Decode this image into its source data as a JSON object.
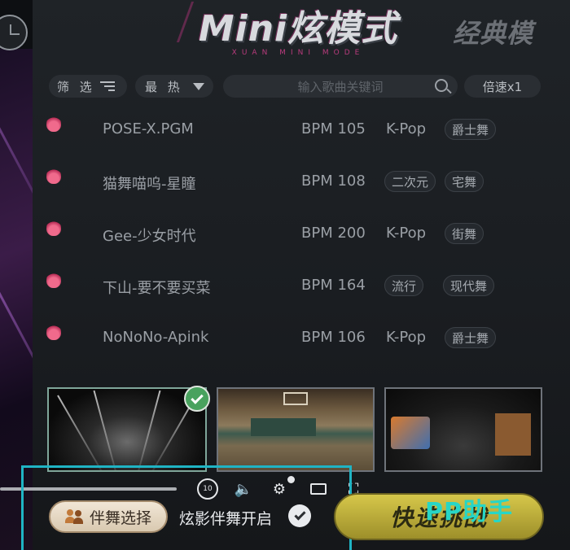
{
  "header": {
    "title": "Mini炫模式",
    "subtitle": "XUAN MINI MODE",
    "classic_tab": "经典模"
  },
  "toolbar": {
    "filter_label": "筛 选",
    "sort_label": "最 热",
    "search_placeholder": "输入歌曲关键词",
    "speed_label": "倍速x1"
  },
  "songs": [
    {
      "name": "POSE-X.PGM",
      "bpm": "BPM 105",
      "tags": [
        "K-Pop",
        "爵士舞"
      ]
    },
    {
      "name": "猫舞喵呜-星瞳",
      "bpm": "BPM 108",
      "tags": [
        "二次元",
        "宅舞"
      ]
    },
    {
      "name": "Gee-少女时代",
      "bpm": "BPM 200",
      "tags": [
        "K-Pop",
        "街舞"
      ]
    },
    {
      "name": "下山-要不要买菜",
      "bpm": "BPM 164",
      "tags": [
        "流行",
        "现代舞"
      ]
    },
    {
      "name": "NoNoNo-Apink",
      "bpm": "BPM 106",
      "tags": [
        "K-Pop",
        "爵士舞"
      ]
    }
  ],
  "video_controls": {
    "replay_label": "10",
    "progress": 0.31
  },
  "bottom": {
    "dance_button": "伴舞选择",
    "shadow_label": "炫影伴舞开启",
    "quick_button": "快速挑战",
    "watermark": "PP助手"
  },
  "colors": {
    "accent_cyan": "#1fb4c4",
    "selected_check": "#49a25e",
    "flame": "#d63c6a"
  }
}
